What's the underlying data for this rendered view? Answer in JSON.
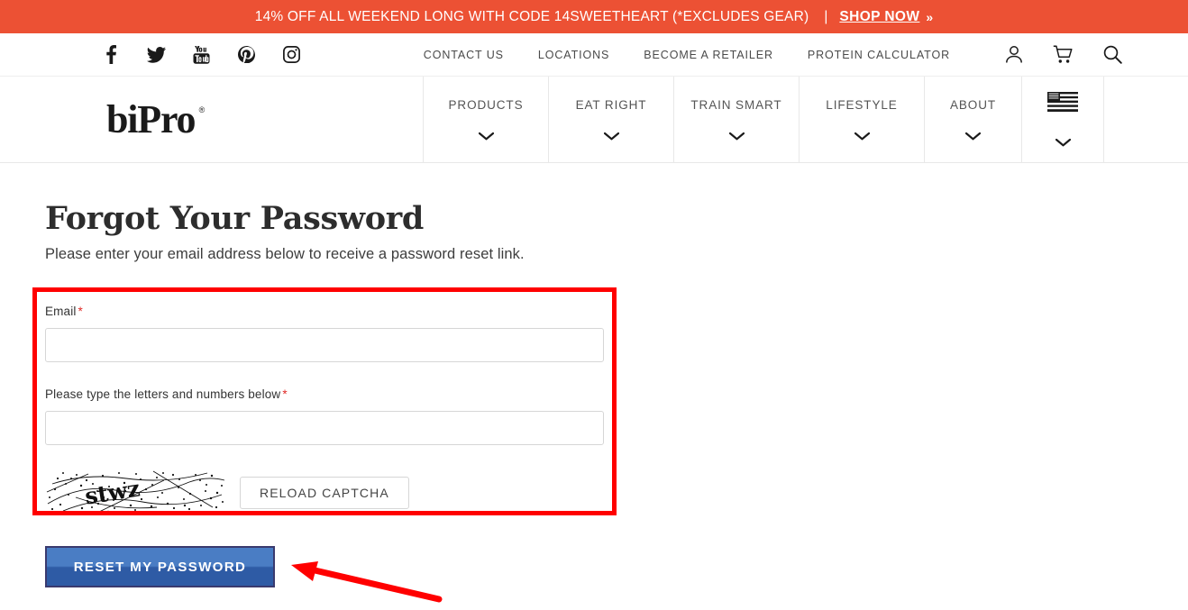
{
  "promo": {
    "text": "14% OFF ALL WEEKEND LONG WITH CODE 14SWEETHEART (*EXCLUDES GEAR)",
    "separator": "|",
    "cta_label": "SHOP NOW",
    "cta_chevron": "»",
    "background_color": "#ec5134",
    "text_color": "#ffffff"
  },
  "utility_bar": {
    "social": [
      {
        "name": "facebook-icon",
        "label": "Facebook"
      },
      {
        "name": "twitter-icon",
        "label": "Twitter"
      },
      {
        "name": "youtube-icon",
        "label": "YouTube"
      },
      {
        "name": "pinterest-icon",
        "label": "Pinterest"
      },
      {
        "name": "instagram-icon",
        "label": "Instagram"
      }
    ],
    "links": [
      {
        "label": "CONTACT US"
      },
      {
        "label": "LOCATIONS"
      },
      {
        "label": "BECOME A RETAILER"
      },
      {
        "label": "PROTEIN CALCULATOR"
      }
    ],
    "icons": [
      {
        "name": "account-icon",
        "label": "My Account"
      },
      {
        "name": "cart-icon",
        "label": "Shopping Cart"
      },
      {
        "name": "search-icon",
        "label": "Search"
      }
    ]
  },
  "header": {
    "logo_text": "biPro",
    "logo_registered": "®",
    "nav": [
      {
        "label": "PRODUCTS",
        "has_dropdown": true
      },
      {
        "label": "EAT RIGHT",
        "has_dropdown": true
      },
      {
        "label": "TRAIN SMART",
        "has_dropdown": true
      },
      {
        "label": "LIFESTYLE",
        "has_dropdown": true
      },
      {
        "label": "ABOUT",
        "has_dropdown": true
      },
      {
        "label": "",
        "icon": "us-flag-icon",
        "has_dropdown": true
      }
    ]
  },
  "page": {
    "title": "Forgot Your Password",
    "subtitle": "Please enter your email address below to receive a password reset link."
  },
  "form": {
    "email": {
      "label": "Email",
      "required_marker": "*",
      "value": "",
      "placeholder": ""
    },
    "captcha": {
      "label": "Please type the letters and numbers below",
      "required_marker": "*",
      "value": "",
      "placeholder": "",
      "image_text": "stwz",
      "reload_label": "Reload captcha"
    },
    "submit_label": "Reset My Password",
    "submit_color": "#2e5ba5"
  },
  "annotations": {
    "highlight_box_color": "#ff0000",
    "arrow_color": "#ff0000"
  }
}
